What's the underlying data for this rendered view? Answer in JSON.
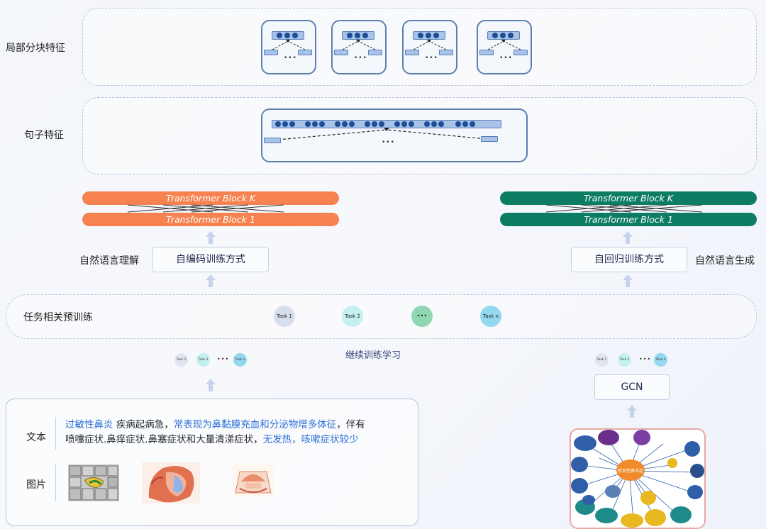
{
  "rows": {
    "local_label": "局部分块特征",
    "sentence_label": "句子特征",
    "task_label": "任务相关预训练",
    "text_label": "文本",
    "image_label": "图片"
  },
  "left_stack": {
    "block_top": "Transformer Block K",
    "block_bottom": "Transformer Block 1",
    "method": "自编码训练方式",
    "side_label": "自然语言理解",
    "color": "#f6824f"
  },
  "right_stack": {
    "block_top": "Transformer Block K",
    "block_bottom": "Transformer Block 1",
    "method": "自回归训练方式",
    "side_label": "自然语言生成",
    "color": "#0c7d63"
  },
  "tasks": {
    "items": [
      "Task 1",
      "Task 2",
      "•••",
      "Task n"
    ],
    "continue_label": "继续训练学习",
    "small_left": [
      "Task 1",
      "Task 2",
      "•••",
      "Task n"
    ],
    "small_right": [
      "Task 1",
      "Task 2",
      "•••",
      "Task n"
    ]
  },
  "ellipsis": "•••",
  "gcn_label": "GCN",
  "text_content": {
    "line1_parts": [
      {
        "t": "过敏性鼻炎",
        "c": "blue"
      },
      {
        "t": " 疾病起病急，",
        "c": "dark"
      },
      {
        "t": "常表现为鼻黏膜充血和分泌物增多体征",
        "c": "blue"
      },
      {
        "t": "，伴有",
        "c": "dark"
      }
    ],
    "line2_parts": [
      {
        "t": "喷嚏症状.鼻痒症状.鼻塞症状和大量清涕症状，",
        "c": "dark"
      },
      {
        "t": "无发热，咳嗽症状较少",
        "c": "blue"
      }
    ]
  },
  "kg": {
    "center": "新发性鼻炎症"
  },
  "icons": [
    "up-arrow-icon",
    "knowledge-graph-icon"
  ]
}
